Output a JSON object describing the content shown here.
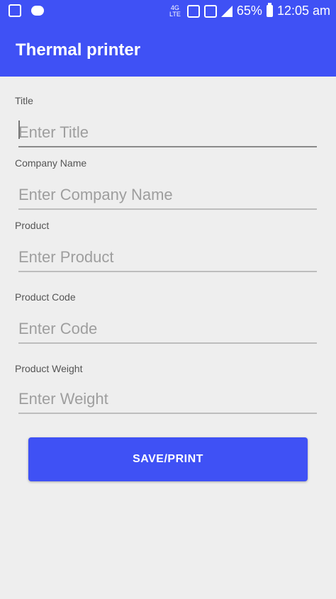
{
  "status_bar": {
    "battery": "65%",
    "time": "12:05 am",
    "network_label": "4G\nLTE",
    "icons": [
      "image-icon",
      "chat-icon",
      "network-icon",
      "wifi-call-icon",
      "sim-icon",
      "signal-icon",
      "battery-icon"
    ]
  },
  "app_bar": {
    "title": "Thermal printer"
  },
  "form": {
    "fields": [
      {
        "label": "Title",
        "placeholder": "Enter Title"
      },
      {
        "label": "Company Name",
        "placeholder": "Enter Company Name"
      },
      {
        "label": "Product",
        "placeholder": "Enter Product"
      },
      {
        "label": "Product Code",
        "placeholder": "Enter Code"
      },
      {
        "label": "Product Weight",
        "placeholder": "Enter Weight"
      }
    ],
    "save_label": "SAVE/PRINT"
  },
  "colors": {
    "primary": "#3f51f5",
    "background": "#eeeeee"
  }
}
